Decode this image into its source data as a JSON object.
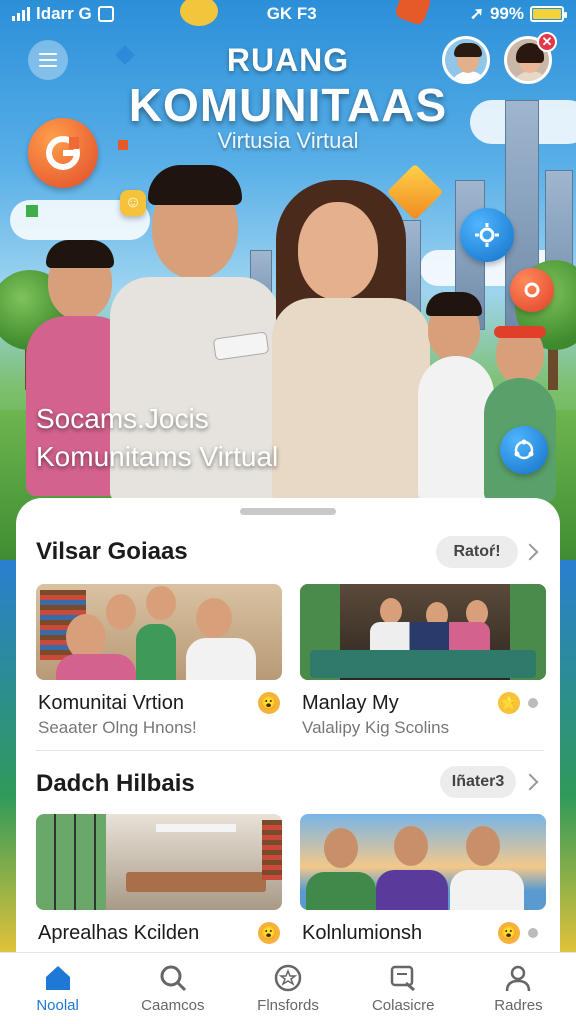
{
  "status_bar": {
    "carrier": "ldarr G",
    "center": "GK F3",
    "battery": "99%",
    "battery_level": 0.99
  },
  "hero": {
    "title_line1": "RUANG",
    "title_line2": "KOMUNITAAS",
    "title_line3": "Virtusia Virtual",
    "caption_line1": "Socams.Jocis",
    "caption_line2": "Komunitams Virtual"
  },
  "notification_badge": "✕",
  "section1": {
    "title": "Vilsar Goiaas",
    "action": "Ratoŕ!",
    "cards": [
      {
        "title": "Komunitai Vrtion",
        "subtitle": "Seaater Olng Hnons!",
        "emoji": "😮"
      },
      {
        "title": "Manlay My",
        "subtitle": "Valalipy Kig Scolins",
        "emoji": "⭐"
      }
    ]
  },
  "section2": {
    "title": "Dadch Hilbais",
    "action": "Iñater3",
    "cards": [
      {
        "title": "Aprealhas",
        "subtitle": "Kcilden",
        "emoji": "😮"
      },
      {
        "title": "Kolnlumionsh",
        "subtitle": "",
        "emoji": "😮"
      }
    ]
  },
  "tabs": [
    {
      "label": "Noolal",
      "icon": "home-icon",
      "active": true
    },
    {
      "label": "Caamcos",
      "icon": "search-icon",
      "active": false
    },
    {
      "label": "Flnsfords",
      "icon": "badge-icon",
      "active": false
    },
    {
      "label": "Colasicre",
      "icon": "edit-icon",
      "active": false
    },
    {
      "label": "Radres",
      "icon": "profile-icon",
      "active": false
    }
  ],
  "colors": {
    "accent": "#1e78d6",
    "sheet": "#ffffff",
    "pill": "#ececec"
  }
}
